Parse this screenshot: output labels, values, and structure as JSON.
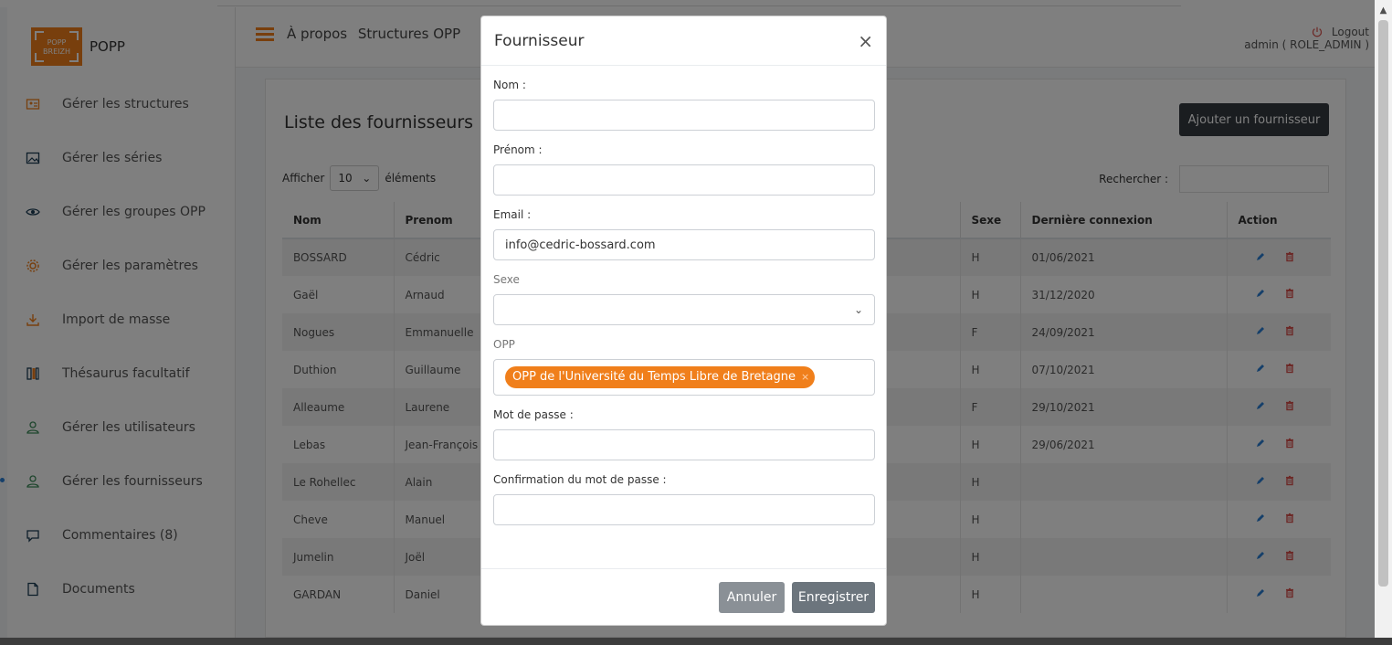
{
  "brand": {
    "logo_line1": "POPP",
    "logo_line2": "BREIZH",
    "name": "POPP"
  },
  "sidebar": {
    "items": [
      {
        "label": "Gérer les structures",
        "icon": "structures-icon"
      },
      {
        "label": "Gérer les séries",
        "icon": "image-icon"
      },
      {
        "label": "Gérer les groupes OPP",
        "icon": "eye-icon"
      },
      {
        "label": "Gérer les paramètres",
        "icon": "gear-icon"
      },
      {
        "label": "Import de masse",
        "icon": "download-icon"
      },
      {
        "label": "Thésaurus facultatif",
        "icon": "book-icon"
      },
      {
        "label": "Gérer les utilisateurs",
        "icon": "user-icon"
      },
      {
        "label": "Gérer les fournisseurs",
        "icon": "user-icon",
        "active": true
      },
      {
        "label": "Commentaires (8)",
        "icon": "comment-icon"
      },
      {
        "label": "Documents",
        "icon": "document-icon"
      }
    ]
  },
  "header": {
    "nav": [
      "À propos",
      "Structures OPP"
    ],
    "logout_label": "Logout",
    "user_label": "admin ( ROLE_ADMIN )"
  },
  "page": {
    "title": "Liste des fournisseurs",
    "add_button": "Ajouter un fournisseur",
    "show_label": "Afficher",
    "show_value": "10",
    "show_suffix": "éléments",
    "search_label": "Rechercher :"
  },
  "table": {
    "columns": [
      "Nom",
      "Prenom",
      "Sexe",
      "Dernière connexion",
      "Action"
    ],
    "rows": [
      {
        "nom": "BOSSARD",
        "prenom": "Cédric",
        "sexe": "H",
        "last": "01/06/2021"
      },
      {
        "nom": "Gaël",
        "prenom": "Arnaud",
        "sexe": "H",
        "last": "31/12/2020"
      },
      {
        "nom": "Nogues",
        "prenom": "Emmanuelle",
        "sexe": "F",
        "last": "24/09/2021"
      },
      {
        "nom": "Duthion",
        "prenom": "Guillaume",
        "sexe": "H",
        "last": "07/10/2021"
      },
      {
        "nom": "Alleaume",
        "prenom": "Laurene",
        "sexe": "F",
        "last": "29/10/2021"
      },
      {
        "nom": "Lebas",
        "prenom": "Jean-François",
        "sexe": "H",
        "last": "29/06/2021"
      },
      {
        "nom": "Le Rohellec",
        "prenom": "Alain",
        "sexe": "H",
        "last": ""
      },
      {
        "nom": "Cheve",
        "prenom": "Manuel",
        "sexe": "H",
        "last": ""
      },
      {
        "nom": "Jumelin",
        "prenom": "Joël",
        "sexe": "H",
        "last": ""
      },
      {
        "nom": "GARDAN",
        "prenom": "Daniel",
        "sexe": "H",
        "last": ""
      }
    ]
  },
  "modal": {
    "title": "Fournisseur",
    "close": "×",
    "nom_label": "Nom :",
    "nom_value": "",
    "prenom_label": "Prénom :",
    "prenom_value": "",
    "email_label": "Email :",
    "email_value": "info@cedric-bossard.com",
    "sexe_label": "Sexe",
    "sexe_value": "",
    "opp_label": "OPP",
    "opp_tag": "OPP de l'Université du Temps Libre de Bretagne",
    "opp_tag_remove": "×",
    "password_label": "Mot de passe :",
    "password_confirm_label": "Confirmation du mot de passe :",
    "cancel_button": "Annuler",
    "save_button": "Enregistrer"
  },
  "colors": {
    "brand_orange": "#f07f1b",
    "dark_button": "#343a40",
    "secondary_button": "#6c757d",
    "icon_blue": "#2a7fd4",
    "icon_red": "#d9534f"
  }
}
